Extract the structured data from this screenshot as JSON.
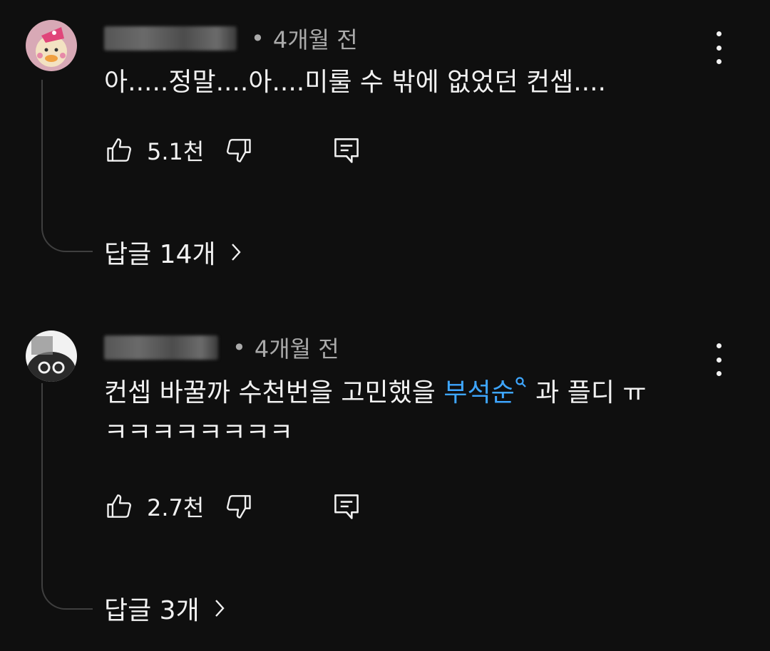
{
  "comments": [
    {
      "time": "4개월 전",
      "separator": "•",
      "text": "아.....정말....아....미룰 수 밖에 없었던 컨셉....",
      "likes": "5.1천",
      "replies_label": "답글 14개"
    },
    {
      "time": "4개월 전",
      "separator": "•",
      "text_before": "컨셉 바꿀까 수천번을 고민했을 ",
      "hashtag": "부석순",
      "text_after": " 과 플디 ㅠ",
      "text_line2": "ㅋㅋㅋㅋㅋㅋㅋㅋ",
      "likes": "2.7천",
      "replies_label": "답글 3개"
    }
  ],
  "colors": {
    "background": "#0f0f0f",
    "text_primary": "#f1f1f1",
    "text_secondary": "#aaaaaa",
    "link": "#3ea6ff",
    "thread_line": "#3f3f3f"
  },
  "icons": [
    "thumbs-up-icon",
    "thumbs-down-icon",
    "reply-icon",
    "more-vert-icon",
    "chevron-right-icon",
    "search-icon"
  ]
}
